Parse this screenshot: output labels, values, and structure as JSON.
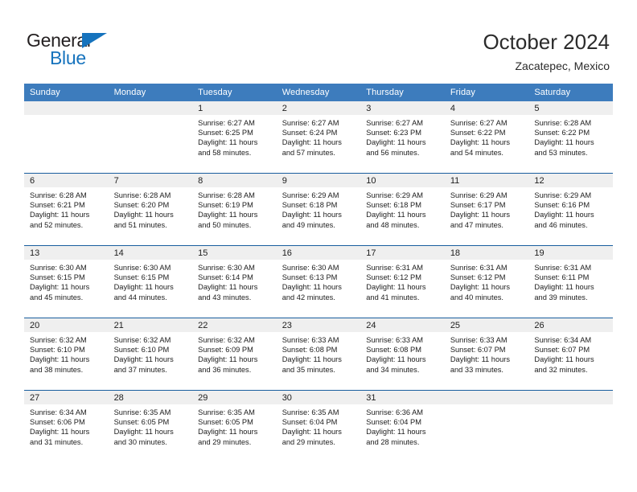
{
  "brand": {
    "name_part1": "General",
    "name_part2": "Blue",
    "color_dark": "#231f20",
    "color_blue": "#1673bd"
  },
  "header": {
    "title": "October 2024",
    "subtitle": "Zacatepec, Mexico"
  },
  "theme": {
    "header_blue": "#3d7cbd",
    "separator_blue": "#195e9e",
    "daynum_band_gray": "#efefef"
  },
  "weekdays": [
    "Sunday",
    "Monday",
    "Tuesday",
    "Wednesday",
    "Thursday",
    "Friday",
    "Saturday"
  ],
  "weeks": [
    [
      {
        "day": "",
        "lines": []
      },
      {
        "day": "",
        "lines": []
      },
      {
        "day": "1",
        "lines": [
          "Sunrise: 6:27 AM",
          "Sunset: 6:25 PM",
          "Daylight: 11 hours",
          "and 58 minutes."
        ]
      },
      {
        "day": "2",
        "lines": [
          "Sunrise: 6:27 AM",
          "Sunset: 6:24 PM",
          "Daylight: 11 hours",
          "and 57 minutes."
        ]
      },
      {
        "day": "3",
        "lines": [
          "Sunrise: 6:27 AM",
          "Sunset: 6:23 PM",
          "Daylight: 11 hours",
          "and 56 minutes."
        ]
      },
      {
        "day": "4",
        "lines": [
          "Sunrise: 6:27 AM",
          "Sunset: 6:22 PM",
          "Daylight: 11 hours",
          "and 54 minutes."
        ]
      },
      {
        "day": "5",
        "lines": [
          "Sunrise: 6:28 AM",
          "Sunset: 6:22 PM",
          "Daylight: 11 hours",
          "and 53 minutes."
        ]
      }
    ],
    [
      {
        "day": "6",
        "lines": [
          "Sunrise: 6:28 AM",
          "Sunset: 6:21 PM",
          "Daylight: 11 hours",
          "and 52 minutes."
        ]
      },
      {
        "day": "7",
        "lines": [
          "Sunrise: 6:28 AM",
          "Sunset: 6:20 PM",
          "Daylight: 11 hours",
          "and 51 minutes."
        ]
      },
      {
        "day": "8",
        "lines": [
          "Sunrise: 6:28 AM",
          "Sunset: 6:19 PM",
          "Daylight: 11 hours",
          "and 50 minutes."
        ]
      },
      {
        "day": "9",
        "lines": [
          "Sunrise: 6:29 AM",
          "Sunset: 6:18 PM",
          "Daylight: 11 hours",
          "and 49 minutes."
        ]
      },
      {
        "day": "10",
        "lines": [
          "Sunrise: 6:29 AM",
          "Sunset: 6:18 PM",
          "Daylight: 11 hours",
          "and 48 minutes."
        ]
      },
      {
        "day": "11",
        "lines": [
          "Sunrise: 6:29 AM",
          "Sunset: 6:17 PM",
          "Daylight: 11 hours",
          "and 47 minutes."
        ]
      },
      {
        "day": "12",
        "lines": [
          "Sunrise: 6:29 AM",
          "Sunset: 6:16 PM",
          "Daylight: 11 hours",
          "and 46 minutes."
        ]
      }
    ],
    [
      {
        "day": "13",
        "lines": [
          "Sunrise: 6:30 AM",
          "Sunset: 6:15 PM",
          "Daylight: 11 hours",
          "and 45 minutes."
        ]
      },
      {
        "day": "14",
        "lines": [
          "Sunrise: 6:30 AM",
          "Sunset: 6:15 PM",
          "Daylight: 11 hours",
          "and 44 minutes."
        ]
      },
      {
        "day": "15",
        "lines": [
          "Sunrise: 6:30 AM",
          "Sunset: 6:14 PM",
          "Daylight: 11 hours",
          "and 43 minutes."
        ]
      },
      {
        "day": "16",
        "lines": [
          "Sunrise: 6:30 AM",
          "Sunset: 6:13 PM",
          "Daylight: 11 hours",
          "and 42 minutes."
        ]
      },
      {
        "day": "17",
        "lines": [
          "Sunrise: 6:31 AM",
          "Sunset: 6:12 PM",
          "Daylight: 11 hours",
          "and 41 minutes."
        ]
      },
      {
        "day": "18",
        "lines": [
          "Sunrise: 6:31 AM",
          "Sunset: 6:12 PM",
          "Daylight: 11 hours",
          "and 40 minutes."
        ]
      },
      {
        "day": "19",
        "lines": [
          "Sunrise: 6:31 AM",
          "Sunset: 6:11 PM",
          "Daylight: 11 hours",
          "and 39 minutes."
        ]
      }
    ],
    [
      {
        "day": "20",
        "lines": [
          "Sunrise: 6:32 AM",
          "Sunset: 6:10 PM",
          "Daylight: 11 hours",
          "and 38 minutes."
        ]
      },
      {
        "day": "21",
        "lines": [
          "Sunrise: 6:32 AM",
          "Sunset: 6:10 PM",
          "Daylight: 11 hours",
          "and 37 minutes."
        ]
      },
      {
        "day": "22",
        "lines": [
          "Sunrise: 6:32 AM",
          "Sunset: 6:09 PM",
          "Daylight: 11 hours",
          "and 36 minutes."
        ]
      },
      {
        "day": "23",
        "lines": [
          "Sunrise: 6:33 AM",
          "Sunset: 6:08 PM",
          "Daylight: 11 hours",
          "and 35 minutes."
        ]
      },
      {
        "day": "24",
        "lines": [
          "Sunrise: 6:33 AM",
          "Sunset: 6:08 PM",
          "Daylight: 11 hours",
          "and 34 minutes."
        ]
      },
      {
        "day": "25",
        "lines": [
          "Sunrise: 6:33 AM",
          "Sunset: 6:07 PM",
          "Daylight: 11 hours",
          "and 33 minutes."
        ]
      },
      {
        "day": "26",
        "lines": [
          "Sunrise: 6:34 AM",
          "Sunset: 6:07 PM",
          "Daylight: 11 hours",
          "and 32 minutes."
        ]
      }
    ],
    [
      {
        "day": "27",
        "lines": [
          "Sunrise: 6:34 AM",
          "Sunset: 6:06 PM",
          "Daylight: 11 hours",
          "and 31 minutes."
        ]
      },
      {
        "day": "28",
        "lines": [
          "Sunrise: 6:35 AM",
          "Sunset: 6:05 PM",
          "Daylight: 11 hours",
          "and 30 minutes."
        ]
      },
      {
        "day": "29",
        "lines": [
          "Sunrise: 6:35 AM",
          "Sunset: 6:05 PM",
          "Daylight: 11 hours",
          "and 29 minutes."
        ]
      },
      {
        "day": "30",
        "lines": [
          "Sunrise: 6:35 AM",
          "Sunset: 6:04 PM",
          "Daylight: 11 hours",
          "and 29 minutes."
        ]
      },
      {
        "day": "31",
        "lines": [
          "Sunrise: 6:36 AM",
          "Sunset: 6:04 PM",
          "Daylight: 11 hours",
          "and 28 minutes."
        ]
      },
      {
        "day": "",
        "lines": []
      },
      {
        "day": "",
        "lines": []
      }
    ]
  ]
}
